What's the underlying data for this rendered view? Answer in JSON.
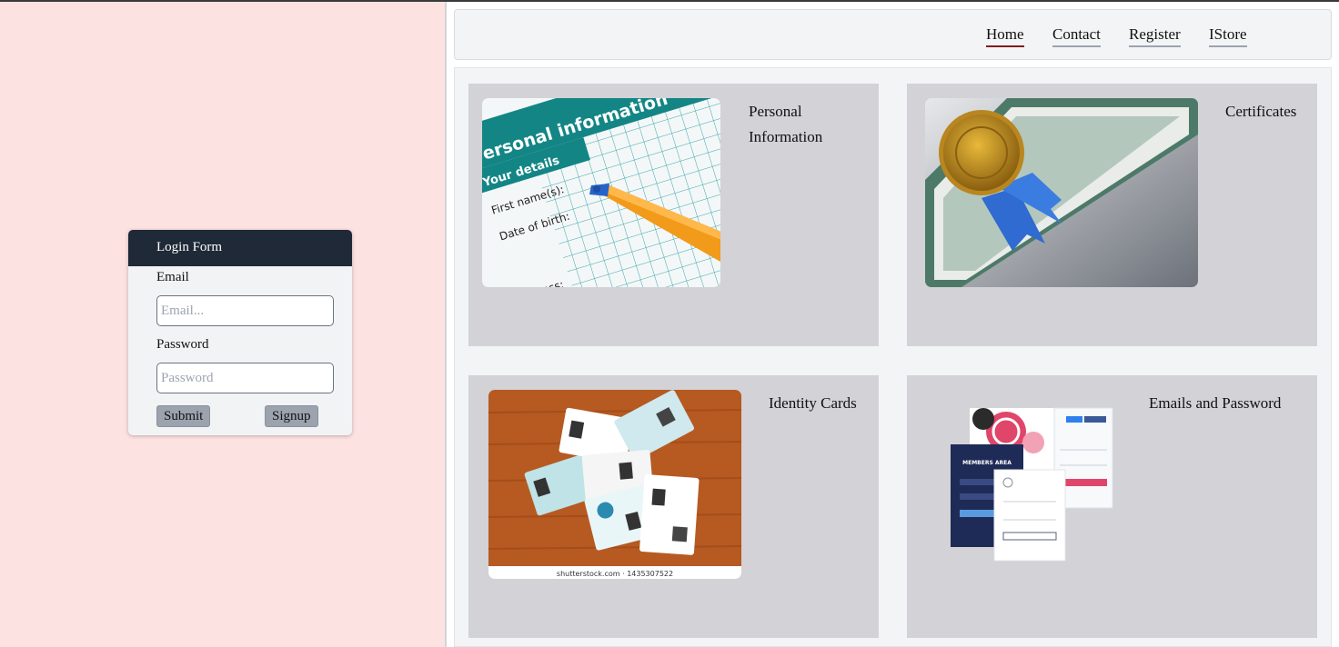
{
  "login": {
    "title": "Login Form",
    "email_label": "Email",
    "email_placeholder": "Email...",
    "email_value": "",
    "password_label": "Password",
    "password_placeholder": "Password",
    "password_value": "",
    "submit_label": "Submit",
    "signup_label": "Signup"
  },
  "nav": {
    "items": [
      {
        "label": "Home",
        "active": true
      },
      {
        "label": "Contact",
        "active": false
      },
      {
        "label": "Register",
        "active": false
      },
      {
        "label": "IStore",
        "active": false
      }
    ]
  },
  "cards": [
    {
      "title_line1": "Personal",
      "title_line2": "Information",
      "image_icon": "personal-information-form-image",
      "image_texts": [
        "Personal information",
        "Your details",
        "First name(s):",
        "Date of birth:",
        "Address:"
      ]
    },
    {
      "title": "Certificates",
      "image_icon": "certificate-seal-image"
    },
    {
      "title": "Identity Cards",
      "image_icon": "identity-cards-image",
      "image_caption": "shutterstock.com · 1435307522"
    },
    {
      "title": "Emails and Password",
      "image_icon": "login-forms-mockup-image",
      "image_texts": [
        "MEMBERS AREA"
      ]
    }
  ],
  "colors": {
    "left_bg": "#fde2e2",
    "login_header": "#1f2937",
    "nav_active_underline": "#7f1d1d",
    "card_bg": "#d2d2d7"
  }
}
